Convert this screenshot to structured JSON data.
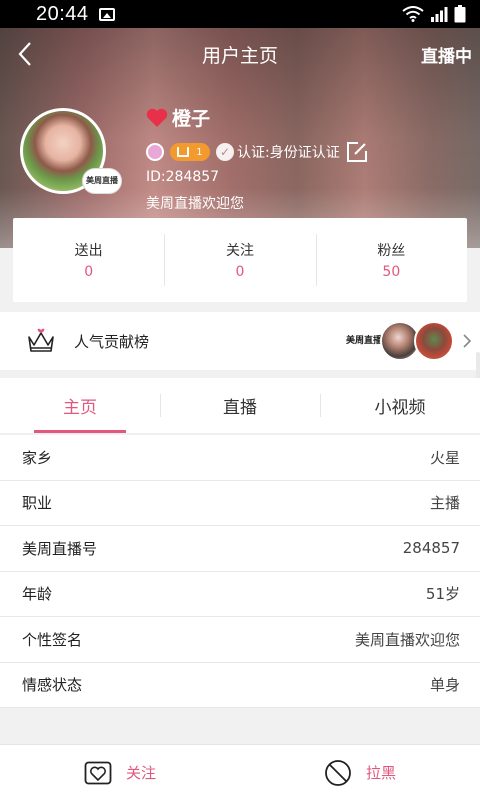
{
  "status_bar": {
    "time": "20:44"
  },
  "nav": {
    "title": "用户主页",
    "live_label": "直播中"
  },
  "profile": {
    "name": "橙子",
    "level": "1",
    "verify_text": "认证:身份证认证",
    "id_text": "ID:284857",
    "signature": "美周直播欢迎您",
    "avatar_badge": "美周直播"
  },
  "stats": [
    {
      "label": "送出",
      "value": "0"
    },
    {
      "label": "关注",
      "value": "0"
    },
    {
      "label": "粉丝",
      "value": "50"
    }
  ],
  "contribution": {
    "label": "人气贡献榜",
    "logo_text": "美周直播"
  },
  "tabs": [
    {
      "label": "主页",
      "active": true
    },
    {
      "label": "直播",
      "active": false
    },
    {
      "label": "小视频",
      "active": false
    }
  ],
  "info_rows": [
    {
      "key": "家乡",
      "value": "火星"
    },
    {
      "key": "职业",
      "value": "主播"
    },
    {
      "key": "美周直播号",
      "value": "284857"
    },
    {
      "key": "年龄",
      "value": "51岁"
    },
    {
      "key": "个性签名",
      "value": "美周直播欢迎您"
    },
    {
      "key": "情感状态",
      "value": "单身"
    }
  ],
  "bottom_actions": {
    "follow_label": "关注",
    "block_label": "拉黑"
  },
  "colors": {
    "accent": "#e2577e",
    "level_badge": "#f29a2e"
  }
}
